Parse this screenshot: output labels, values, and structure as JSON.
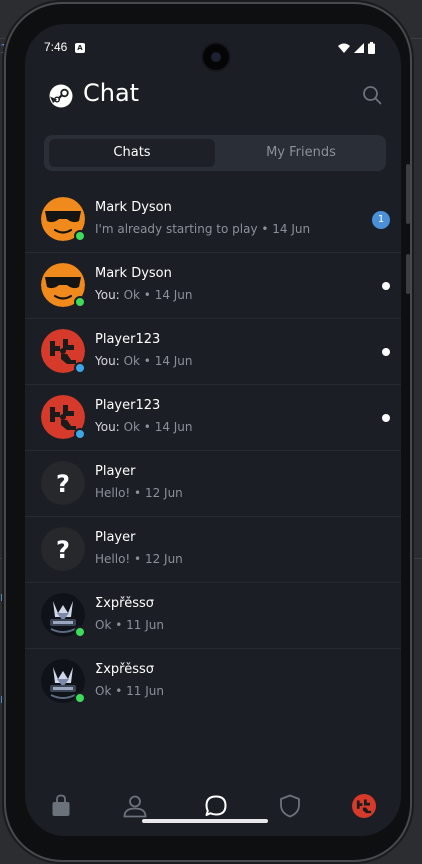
{
  "status_bar": {
    "time": "7:46",
    "notification_icon": "A"
  },
  "header": {
    "title": "Chat",
    "logo_icon": "steam-logo-icon",
    "search_icon": "search-icon"
  },
  "tabs": [
    {
      "label": "Chats",
      "active": true
    },
    {
      "label": "My Friends",
      "active": false
    }
  ],
  "chats": [
    {
      "name": "Mark Dyson",
      "you_prefix": "",
      "message": "I'm already starting to play",
      "date": "14 Jun",
      "avatar": "sunglasses-emoji",
      "presence": "online",
      "unread": "1"
    },
    {
      "name": "Mark Dyson",
      "you_prefix": "You:",
      "message": "Ok",
      "date": "14 Jun",
      "avatar": "sunglasses-emoji",
      "presence": "online",
      "unread": "dot"
    },
    {
      "name": "Player123",
      "you_prefix": "You:",
      "message": "Ok",
      "date": "14 Jun",
      "avatar": "rust-logo",
      "presence": "away",
      "unread": "dot"
    },
    {
      "name": "Player123",
      "you_prefix": "You:",
      "message": "Ok",
      "date": "14 Jun",
      "avatar": "rust-logo",
      "presence": "away",
      "unread": "dot"
    },
    {
      "name": "Player",
      "you_prefix": "",
      "message": "Hello!",
      "date": "12 Jun",
      "avatar": "question-mark",
      "presence": "none",
      "unread": ""
    },
    {
      "name": "Player",
      "you_prefix": "",
      "message": "Hello!",
      "date": "12 Jun",
      "avatar": "question-mark",
      "presence": "none",
      "unread": ""
    },
    {
      "name": "Σxpřěssσ",
      "you_prefix": "",
      "message": "Ok",
      "date": "11 Jun",
      "avatar": "espresso-art",
      "presence": "online",
      "unread": ""
    },
    {
      "name": "Σxpřěssσ",
      "you_prefix": "",
      "message": "Ok",
      "date": "11 Jun",
      "avatar": "espresso-art",
      "presence": "online",
      "unread": ""
    }
  ],
  "bottom_nav": [
    {
      "icon": "shopping-bag-icon",
      "active": false
    },
    {
      "icon": "profile-icon",
      "active": false
    },
    {
      "icon": "chat-bubble-icon",
      "active": true
    },
    {
      "icon": "shield-icon",
      "active": false
    },
    {
      "icon": "user-avatar-icon",
      "active": false
    }
  ],
  "colors": {
    "background": "#1b1e24",
    "tab_bar": "#2a2e36",
    "online": "#3ddc5a",
    "away": "#3ca7e6",
    "badge": "#4a90d9"
  }
}
